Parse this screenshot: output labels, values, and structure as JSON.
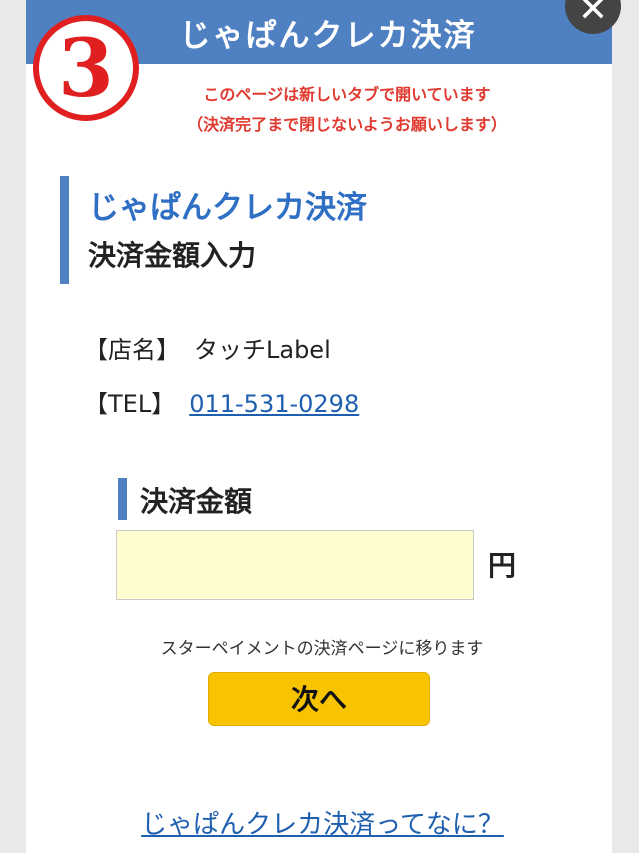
{
  "header": {
    "title": "じゃぱんクレカ決済",
    "close_symbol": "✕"
  },
  "step_badge": {
    "number": "3"
  },
  "notice": {
    "line1": "このページは新しいタブで開いています",
    "line2": "（決済完了まで閉じないようお願いします）",
    "color": "#e0392f"
  },
  "section": {
    "title": "じゃぱんクレカ決済",
    "subtitle": "決済金額入力"
  },
  "shop": {
    "name_label": "【店名】",
    "name_value": "タッチLabel",
    "tel_label": "【TEL】",
    "tel_value": "011-531-0298"
  },
  "amount": {
    "title": "決済金額",
    "value": "",
    "unit": "円"
  },
  "redirect_note": "スターペイメントの決済ページに移ります",
  "next_button": "次へ",
  "help_link": "じゃぱんクレカ決済ってなに？",
  "colors": {
    "header_bg": "#4f80c2",
    "link": "#1e5fb0",
    "button_bg": "#f8c300",
    "input_bg": "#fffccf"
  }
}
